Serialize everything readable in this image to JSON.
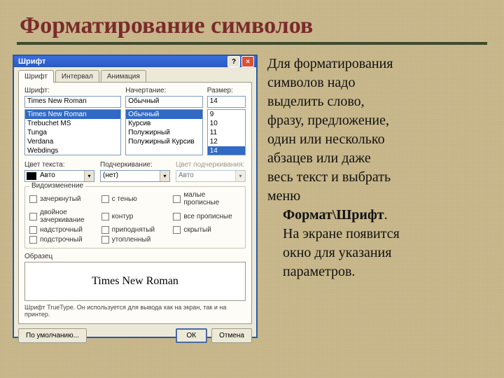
{
  "title": "Форматирование символов",
  "body": {
    "p1_line1": "Для форматирования\nсимволов надо\nвыделить слово,\nфразу, предложение,\nодин или несколько\nабзацев или даже\nвесь текст и выбрать\nменю",
    "menu_ref": "Формат\\Шрифт",
    "period": ".",
    "p2": "На экране появится\nокно для указания\nпараметров."
  },
  "dialog": {
    "window_title": "Шрифт",
    "help_icon": "?",
    "close_icon": "×",
    "tabs": {
      "t0": "Шрифт",
      "t1": "Интервал",
      "t2": "Анимация"
    },
    "font": {
      "label": "Шрифт:",
      "value": "Times New Roman",
      "options": [
        "Times New Roman",
        "Trebuchet MS",
        "Tunga",
        "Verdana",
        "Webdings"
      ]
    },
    "style": {
      "label": "Начертание:",
      "value": "Обычный",
      "options": [
        "Обычный",
        "Курсив",
        "Полужирный",
        "Полужирный Курсив"
      ]
    },
    "size": {
      "label": "Размер:",
      "value": "14",
      "options": [
        "9",
        "10",
        "11",
        "12",
        "14"
      ]
    },
    "color": {
      "label": "Цвет текста:",
      "value": "Авто"
    },
    "underline": {
      "label": "Подчеркивание:",
      "value": "(нет)"
    },
    "ucolor": {
      "label": "Цвет подчеркивания:",
      "value": "Авто"
    },
    "mods": {
      "legend": "Видоизменение",
      "c0": "зачеркнутый",
      "c1": "с тенью",
      "c2": "малые прописные",
      "c3": "двойное зачеркивание",
      "c4": "контур",
      "c5": "все прописные",
      "c6": "надстрочный",
      "c7": "приподнятый",
      "c8": "скрытый",
      "c9": "подстрочный",
      "c10": "утопленный"
    },
    "sample": {
      "label": "Образец",
      "text": "Times New Roman"
    },
    "hint": "Шрифт TrueType. Он используется для вывода как на экран, так и на принтер.",
    "buttons": {
      "default_btn": "По умолчанию...",
      "ok": "ОК",
      "cancel": "Отмена"
    }
  }
}
